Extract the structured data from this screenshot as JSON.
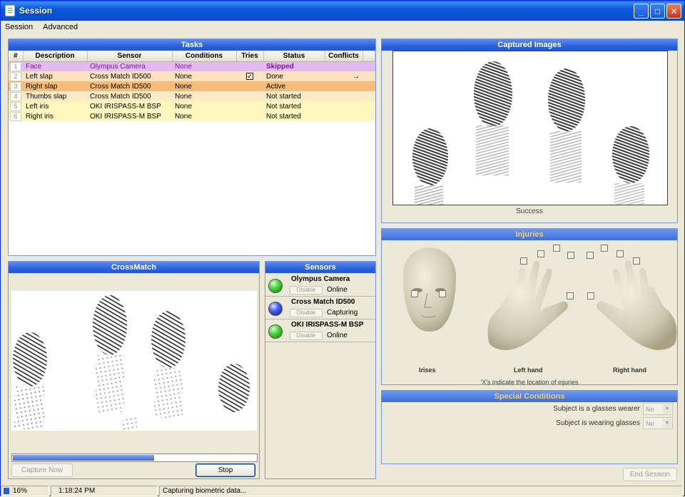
{
  "window": {
    "title": "Session"
  },
  "menu": [
    {
      "label": "Session"
    },
    {
      "label": "Advanced"
    }
  ],
  "tasks": {
    "title": "Tasks",
    "columns": [
      "#",
      "Description",
      "Sensor",
      "Conditions",
      "Tries",
      "Status",
      "Conflicts"
    ],
    "rows": [
      {
        "num": "1",
        "description": "Face",
        "sensor": "Olympus Camera",
        "conditions": "None",
        "tries": "",
        "status": "Skipped",
        "conflicts": ""
      },
      {
        "num": "2",
        "description": "Left slap",
        "sensor": "Cross Match ID500",
        "conditions": "None",
        "tries": "checked",
        "status": "Done",
        "conflicts": "→"
      },
      {
        "num": "3",
        "description": "Right slap",
        "sensor": "Cross Match ID500",
        "conditions": "None",
        "tries": "",
        "status": "Active",
        "conflicts": ""
      },
      {
        "num": "4",
        "description": "Thumbs slap",
        "sensor": "Cross Match ID500",
        "conditions": "None",
        "tries": "",
        "status": "Not started",
        "conflicts": ""
      },
      {
        "num": "5",
        "description": "Left iris",
        "sensor": "OKI IRISPASS-M BSP",
        "conditions": "None",
        "tries": "",
        "status": "Not started",
        "conflicts": ""
      },
      {
        "num": "6",
        "description": "Right iris",
        "sensor": "OKI IRISPASS-M BSP",
        "conditions": "None",
        "tries": "",
        "status": "Not started",
        "conflicts": ""
      }
    ]
  },
  "captured": {
    "title": "Captured Images",
    "status": "Success"
  },
  "injuries": {
    "title": "Injuries",
    "labels": {
      "irises": "Irises",
      "left_hand": "Left hand",
      "right_hand": "Right hand"
    },
    "note": "'X's indicate the location of injuries"
  },
  "special": {
    "title": "Special Conditions",
    "rows": [
      {
        "label": "Subject is a glasses wearer",
        "value": "No"
      },
      {
        "label": "Subject is wearing glasses",
        "value": "No"
      }
    ],
    "end_session": "End Session"
  },
  "crossmatch": {
    "title": "CrossMatch",
    "progress": 0.58,
    "capture_now": "Capture Now",
    "stop": "Stop"
  },
  "sensors": {
    "title": "Sensors",
    "items": [
      {
        "name": "Olympus Camera",
        "button": "Disable",
        "state": "Online",
        "led": "green"
      },
      {
        "name": "Cross Match ID500",
        "button": "Disable",
        "state": "Capturing",
        "led": "blue"
      },
      {
        "name": "OKI IRISPASS-M BSP",
        "button": "Disable",
        "state": "Online",
        "led": "green"
      }
    ]
  },
  "statusbar": {
    "percent": "16%",
    "time": "1:18:24 PM",
    "message": "Capturing biometric data..."
  }
}
